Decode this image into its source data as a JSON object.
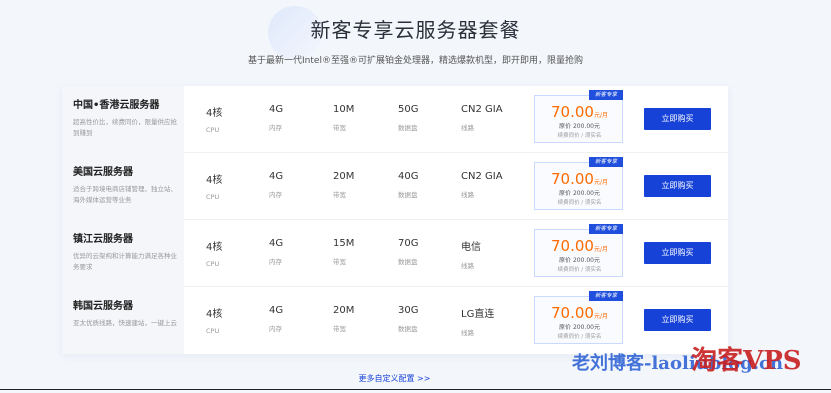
{
  "header": {
    "title": "新客专享云服务器套餐",
    "subtitle": "基于最新一代Intel®至强®可扩展铂金处理器，精选爆款机型，即开即用，限量抢购"
  },
  "spec_labels": {
    "cpu": "CPU",
    "ram": "内存",
    "bandwidth": "带宽",
    "disk": "数据盘",
    "line": "线路"
  },
  "plans": [
    {
      "name": "中国•香港云服务器",
      "desc": "超高性价比，续费同价，限量供应抢到赚到",
      "cpu": "4核",
      "ram": "4G",
      "bandwidth": "10M",
      "disk": "50G",
      "line": "CN2 GIA",
      "badge": "新客专享",
      "price": "70.00",
      "unit": "元/月",
      "orig": "原价 200.00元",
      "note": "续费同价 / 须实名",
      "buy": "立即购买"
    },
    {
      "name": "美国云服务器",
      "desc": "适合于跨境电商店铺管理、独立站、海外媒体运营等业务",
      "cpu": "4核",
      "ram": "4G",
      "bandwidth": "20M",
      "disk": "40G",
      "line": "CN2 GIA",
      "badge": "新客专享",
      "price": "70.00",
      "unit": "元/月",
      "orig": "原价 200.00元",
      "note": "续费同价 / 须实名",
      "buy": "立即购买"
    },
    {
      "name": "镇江云服务器",
      "desc": "优异的云架构和计算能力满足各种业务要求",
      "cpu": "4核",
      "ram": "4G",
      "bandwidth": "15M",
      "disk": "70G",
      "line": "电信",
      "badge": "新客专享",
      "price": "70.00",
      "unit": "元/月",
      "orig": "原价 200.00元",
      "note": "续费同价 / 须实名",
      "buy": "立即购买"
    },
    {
      "name": "韩国云服务器",
      "desc": "亚太优质线路，快速建站，一键上云",
      "cpu": "4核",
      "ram": "4G",
      "bandwidth": "20M",
      "disk": "30G",
      "line": "LG直连",
      "badge": "新客专享",
      "price": "70.00",
      "unit": "元/月",
      "orig": "原价 200.00元",
      "note": "续费同价 / 须实名",
      "buy": "立即购买"
    }
  ],
  "more_link": "更多自定义配置 >>",
  "watermark": {
    "text_a": "老刘博客-laoliublog.cn",
    "text_b": "淘客VPS"
  },
  "colors": {
    "accent": "#1742d8",
    "price": "#ff6a00",
    "badge": "#1f4fdc"
  }
}
